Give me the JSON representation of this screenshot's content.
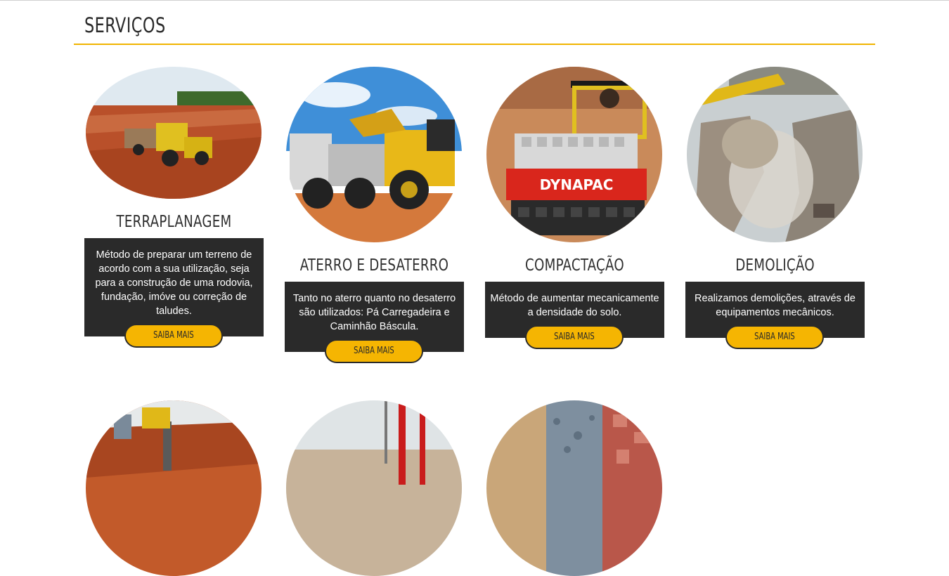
{
  "section": {
    "title": "SERVIÇOS"
  },
  "services": [
    {
      "title": "TERRAPLANAGEM",
      "description": "Método de preparar um terreno de acordo com a sua utilização, seja para a construção de uma rodovia, fundação, imóve ou correção de taludes.",
      "button": "SAIBA MAIS"
    },
    {
      "title": "ATERRO E DESATERRO",
      "description": "Tanto no aterro quanto no desaterro são utilizados: Pá Carregadeira e Caminhão Báscula.",
      "button": "SAIBA MAIS"
    },
    {
      "title": "COMPACTAÇÃO",
      "description": "Método de aumentar mecanicamente a densidade do solo.",
      "button": "SAIBA MAIS",
      "photo_text": "DYNAPAC"
    },
    {
      "title": "DEMOLIÇÃO",
      "description": "Realizamos demolições, através de equipamentos mecânicos.",
      "button": "SAIBA MAIS"
    }
  ],
  "colors": {
    "accent": "#f5b502",
    "box": "#2a2a2a",
    "rule": "#f0b400"
  }
}
